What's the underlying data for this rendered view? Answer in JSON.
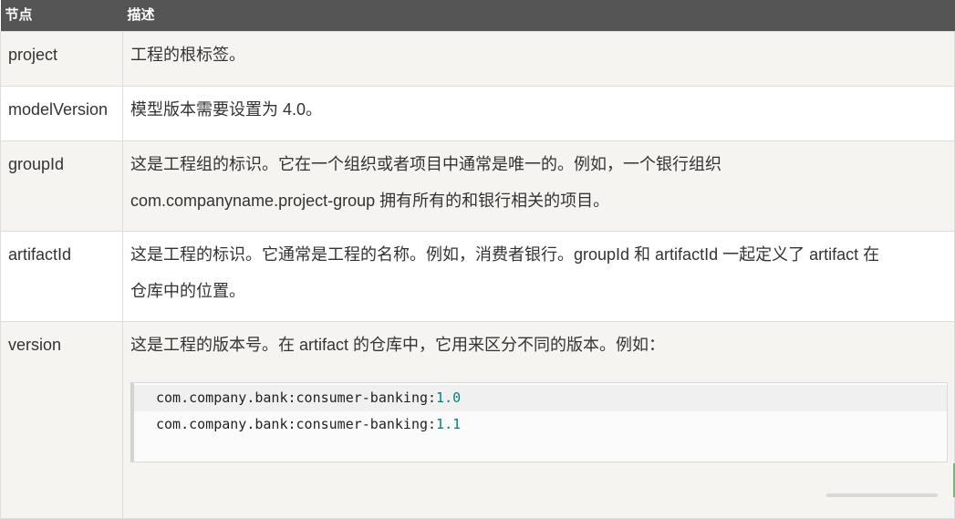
{
  "table": {
    "headers": {
      "node": "节点",
      "description": "描述"
    },
    "rows": [
      {
        "node": "project",
        "line1": "工程的根标签。",
        "line2": ""
      },
      {
        "node": "modelVersion",
        "line1": "模型版本需要设置为 4.0。",
        "line2": ""
      },
      {
        "node": "groupId",
        "line1": "这是工程组的标识。它在一个组织或者项目中通常是唯一的。例如，一个银行组织",
        "line2": "com.companyname.project-group 拥有所有的和银行相关的项目。"
      },
      {
        "node": "artifactId",
        "line1": "这是工程的标识。它通常是工程的名称。例如，消费者银行。groupId 和 artifactId 一起定义了 artifact 在",
        "line2": "仓库中的位置。"
      },
      {
        "node": "version",
        "line1": "这是工程的版本号。在 artifact 的仓库中，它用来区分不同的版本。例如：",
        "line2": ""
      }
    ],
    "code": [
      {
        "prefix": "com.company.bank:consumer-banking:",
        "version": "1.0"
      },
      {
        "prefix": "com.company.bank:consumer-banking:",
        "version": "1.1"
      }
    ]
  },
  "colors": {
    "header_bg": "#555555",
    "odd_row_bg": "#f6f4f0",
    "border": "#dddddd",
    "code_number": "#008080"
  }
}
